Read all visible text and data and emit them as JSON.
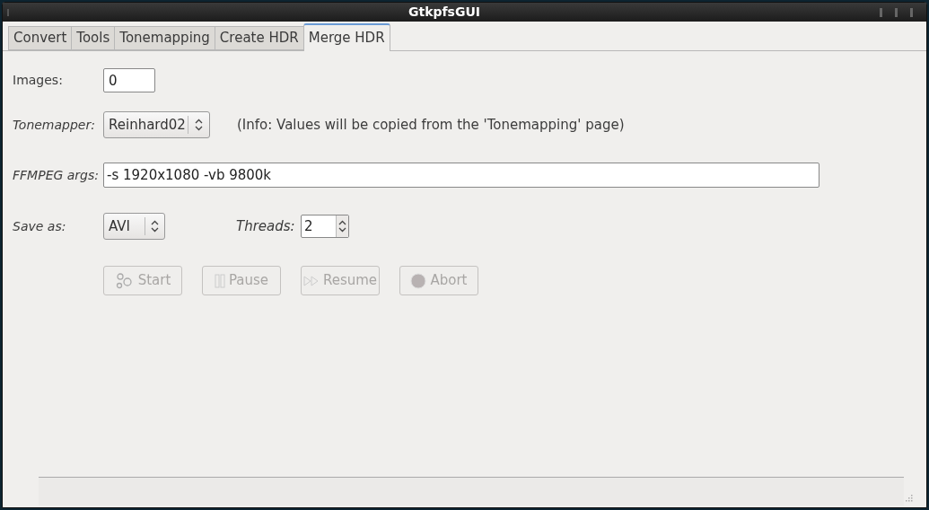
{
  "window": {
    "title": "GtkpfsGUI"
  },
  "tabs": [
    {
      "label": "Convert",
      "selected": false
    },
    {
      "label": "Tools",
      "selected": false
    },
    {
      "label": "Tonemapping",
      "selected": false
    },
    {
      "label": "Create HDR",
      "selected": false
    },
    {
      "label": "Merge HDR",
      "selected": true
    }
  ],
  "images": {
    "label": "Images:",
    "italic": false,
    "value": "0"
  },
  "tonemapper": {
    "label": "Tonemapper:",
    "italic": true,
    "value": "Reinhard02",
    "info": "(Info: Values will be copied from the 'Tonemapping' page)"
  },
  "ffmpeg": {
    "label": "FFMPEG args:",
    "italic": true,
    "value": "-s 1920x1080 -vb 9800k"
  },
  "save_as": {
    "label": "Save as:",
    "italic": true,
    "value": "AVI"
  },
  "threads": {
    "label": "Threads:",
    "italic": true,
    "value": "2"
  },
  "buttons": [
    {
      "kind": "start",
      "label": "Start",
      "disabled": true
    },
    {
      "kind": "pause",
      "label": "Pause",
      "disabled": true
    },
    {
      "kind": "resume",
      "label": "Resume",
      "disabled": true
    },
    {
      "kind": "abort",
      "label": "Abort",
      "disabled": true
    }
  ]
}
